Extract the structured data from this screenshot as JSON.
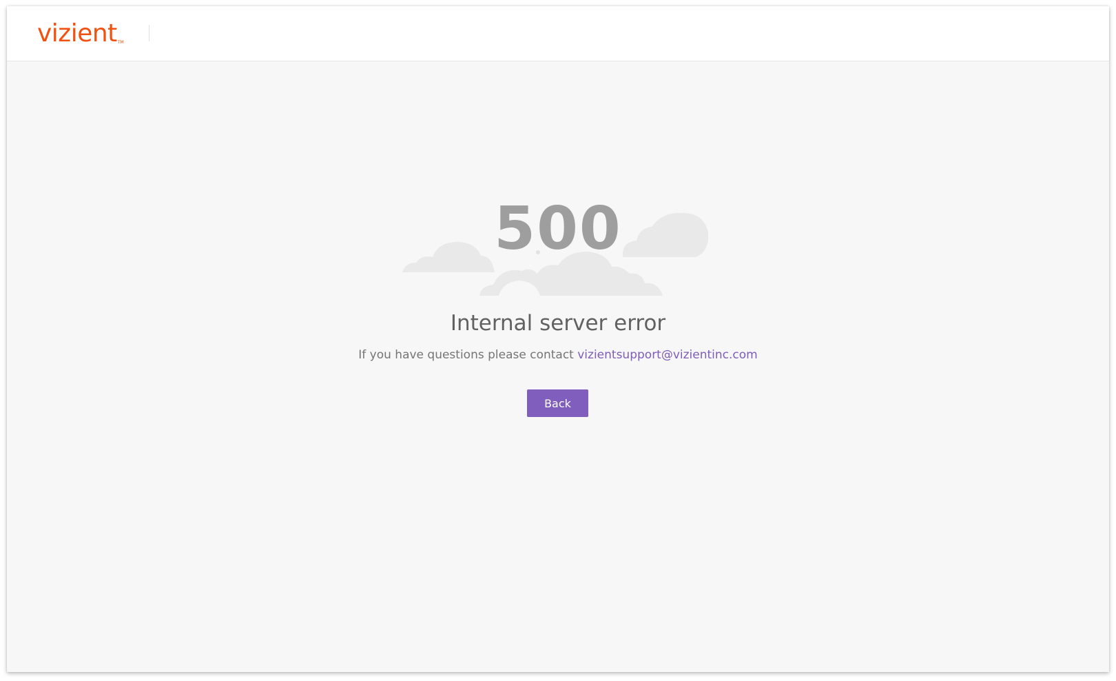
{
  "header": {
    "logo_text": "vizient",
    "logo_tm": "TM"
  },
  "error": {
    "code": "500",
    "title": "Internal server error",
    "contact_prefix": "If you have questions please contact ",
    "contact_email": "vizientsupport@vizientinc.com",
    "back_label": "Back",
    "illustration_icon": "clouds-illustration"
  },
  "colors": {
    "brand_orange": "#f2500f",
    "accent_purple": "#7f5ebd",
    "link_purple": "#7e5cb7",
    "background": "#f7f7f7"
  }
}
